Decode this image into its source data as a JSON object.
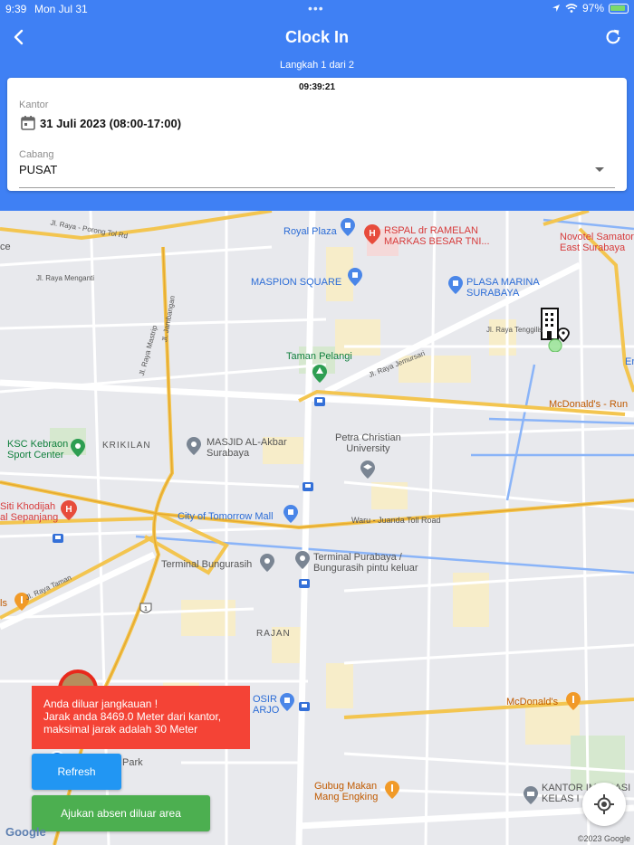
{
  "status_bar": {
    "time": "9:39",
    "date": "Mon Jul 31",
    "battery": "97%"
  },
  "header": {
    "title": "Clock In",
    "step": "Langkah 1 dari 2"
  },
  "card": {
    "clock": "09:39:21",
    "kantor_label": "Kantor",
    "kantor_value": "31 Juli 2023 (08:00-17:00)",
    "cabang_label": "Cabang",
    "cabang_value": "PUSAT"
  },
  "map": {
    "pois": {
      "royal_plaza": "Royal Plaza",
      "rspal_1": "RSPAL dr RAMELAN",
      "rspal_2": "MARKAS BESAR TNI...",
      "novotel_1": "Novotel Samator",
      "novotel_2": "East Surabaya",
      "maspion": "MASPION SQUARE",
      "plasa_marina_1": "PLASA MARINA",
      "plasa_marina_2": "SURABAYA",
      "taman_pelangi": "Taman Pelangi",
      "mcd_rungkut": "McDonald's - Run",
      "ksc_1": "KSC Kebraon",
      "ksc_2": "Sport Center",
      "masjid_1": "MASJID AL-Akbar",
      "masjid_2": "Surabaya",
      "petra_1": "Petra Christian",
      "petra_2": "University",
      "siti_1": "Siti Khodijah",
      "siti_2": "al Sepanjang",
      "city_tomorrow": "City of Tomorrow Mall",
      "terminal_bungurasih": "Terminal Bungurasih",
      "terminal_purabaya_1": "Terminal Purabaya /",
      "terminal_purabaya_2": "Bungurasih pintu keluar",
      "mcd_2": "McDonald's",
      "osir_1": "OSIR",
      "osir_2": "ARJO",
      "park": "Park",
      "gubug_1": "Gubug Makan",
      "gubug_2": "Mang Engking",
      "kantor_imigrasi_1": "KANTOR IMIGRASI",
      "kantor_imigrasi_2": "KELAS I",
      "krikilan": "KRIKILAN",
      "rajan": "RAJAN",
      "road_porong": "Jl. Raya - Porong Tol Rd",
      "road_menganti": "Jl. Raya Menganti",
      "road_jambangan": "Jl. Jambangan",
      "road_mastrip": "Jl. Raya Mastrip",
      "road_jemursari": "Jl. Raya Jemursari",
      "road_tenggilis": "Jl. Raya Tenggilis",
      "road_waru": "Waru - Juanda Toll Road",
      "road_taman": "Jl. Raya Taman",
      "left_ce": "ce",
      "right_er": "Er",
      "left_ls": "ls",
      "google": "Google",
      "copyright": "©2023 Google"
    }
  },
  "alert": {
    "line1": "Anda diluar jangkauan !",
    "line2": "Jarak anda 8469.0 Meter dari kantor,",
    "line3": "maksimal jarak adalah 30 Meter"
  },
  "buttons": {
    "refresh": "Refresh",
    "ajukan": "Ajukan absen diluar area"
  }
}
